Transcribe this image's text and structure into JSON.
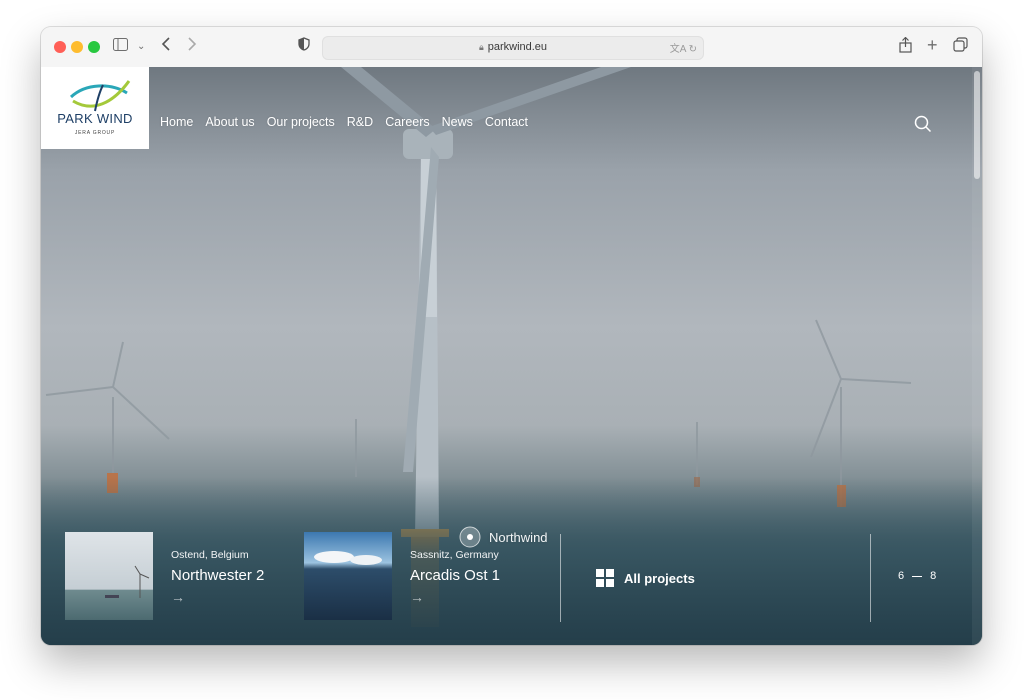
{
  "browser": {
    "address": "parkwind.eu",
    "icons": [
      "sidebar-icon",
      "chevron-down-icon",
      "back-icon",
      "forward-icon",
      "shield-icon",
      "lock-icon",
      "translate-icon",
      "reload-icon",
      "share-icon",
      "new-tab-icon",
      "tabs-overview-icon"
    ]
  },
  "site": {
    "logo": {
      "name": "PARK WIND",
      "sub": "JERA GROUP",
      "colors": [
        "#1e3f66",
        "#2aa7b8",
        "#a4c93a"
      ]
    },
    "nav": [
      "Home",
      "About us",
      "Our projects",
      "R&D",
      "Careers",
      "News",
      "Contact"
    ],
    "search_icon": "search-icon",
    "hero": {
      "marker_label": "Northwind",
      "cards": [
        {
          "location": "Ostend, Belgium",
          "title": "Northwester 2"
        },
        {
          "location": "Sassnitz, Germany",
          "title": "Arcadis Ost 1"
        }
      ],
      "all_projects_label": "All projects",
      "pager": {
        "current": "6",
        "total": "8"
      }
    }
  }
}
